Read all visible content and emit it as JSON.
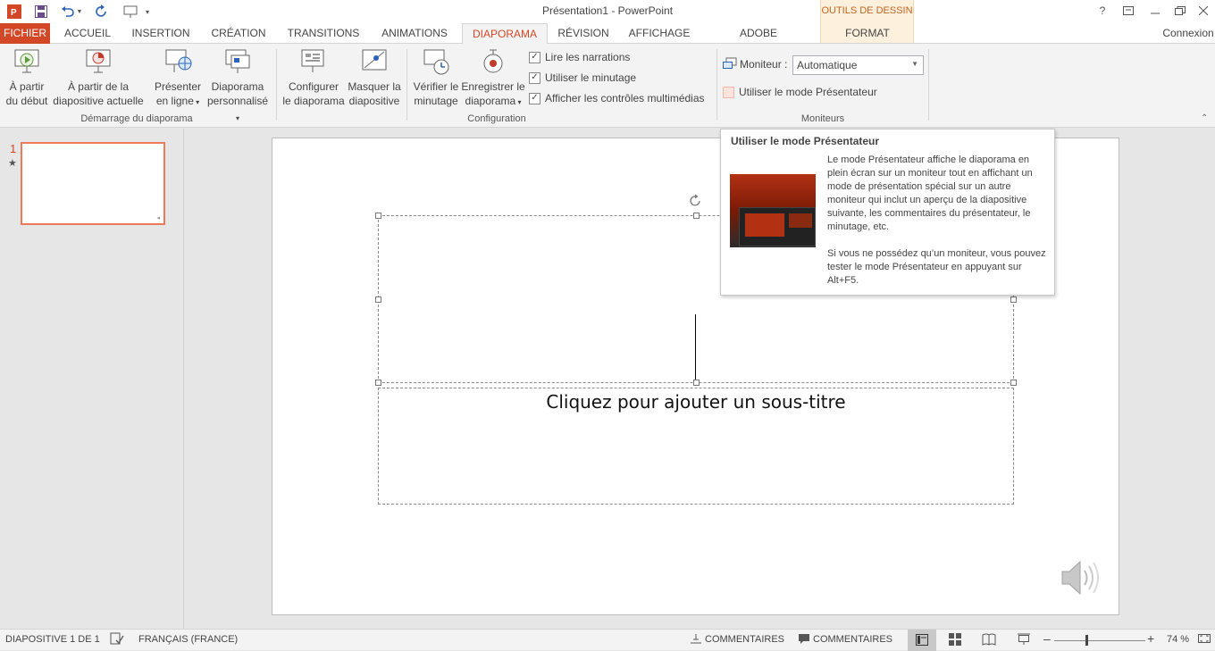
{
  "window": {
    "title": "Présentation1 - PowerPoint",
    "help": "?",
    "signin": "Connexion"
  },
  "contextual": {
    "label": "OUTILS DE DESSIN",
    "tab": "FORMAT"
  },
  "tabs": [
    "FICHIER",
    "ACCUEIL",
    "INSERTION",
    "CRÉATION",
    "TRANSITIONS",
    "ANIMATIONS",
    "DIAPORAMA",
    "RÉVISION",
    "AFFICHAGE",
    "ADOBE PRESENTER"
  ],
  "active_tab": "DIAPORAMA",
  "ribbon": {
    "start": {
      "from_start": [
        "À partir",
        "du début"
      ],
      "from_current": [
        "À partir de la",
        "diapositive actuelle"
      ],
      "present_online": [
        "Présenter",
        "en ligne"
      ],
      "custom_show": [
        "Diaporama",
        "personnalisé"
      ],
      "group_label": "Démarrage du diaporama"
    },
    "config": {
      "setup": [
        "Configurer",
        "le diaporama"
      ],
      "hide": [
        "Masquer la",
        "diapositive"
      ],
      "rehearse": [
        "Vérifier le",
        "minutage"
      ],
      "record": [
        "Enregistrer le",
        "diaporama"
      ],
      "play_narrations": "Lire les narrations",
      "use_timings": "Utiliser le minutage",
      "show_media_controls": "Afficher les contrôles multimédias",
      "group_label": "Configuration"
    },
    "monitors": {
      "monitor_label": "Moniteur :",
      "monitor_value": "Automatique",
      "presenter_view": "Utiliser le mode Présentateur",
      "group_label": "Moniteurs"
    }
  },
  "thumbnails": [
    {
      "number": "1",
      "star": "★"
    }
  ],
  "slide": {
    "subtitle_placeholder": "Cliquez pour ajouter un sous-titre"
  },
  "tooltip": {
    "title": "Utiliser le mode Présentateur",
    "para1": "Le mode Présentateur affiche le diaporama en plein écran sur un moniteur tout en affichant un mode de présentation spécial sur un autre moniteur qui inclut un aperçu de la diapositive suivante, les commentaires du présentateur, le minutage, etc.",
    "para2": "Si vous ne possédez qu’un moniteur, vous pouvez tester le mode Présentateur en appuyant sur Alt+F5."
  },
  "status": {
    "slide_count": "DIAPOSITIVE 1 DE 1",
    "language": "FRANÇAIS (FRANCE)",
    "notes": "COMMENTAIRES",
    "comments": "COMMENTAIRES",
    "zoom": "74 %",
    "zoom_minus": "–",
    "zoom_plus": "+"
  },
  "colors": {
    "accent": "#d24726",
    "contextual_text": "#c5641f",
    "contextual_bg": "#fdf0dc"
  }
}
